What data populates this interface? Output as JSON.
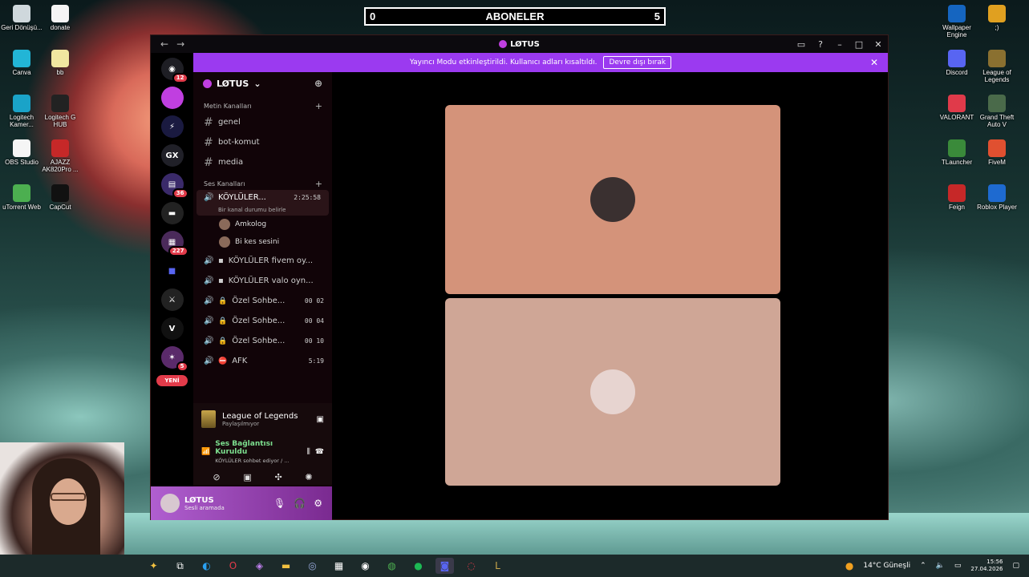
{
  "subscriber_bar": {
    "left_value": "0",
    "label": "ABONELER",
    "right_value": "5"
  },
  "desktop_left": [
    {
      "label": "Geri Dönüşü...",
      "icon": "recycle-bin-icon",
      "color": "#cfd8dc"
    },
    {
      "label": "donate",
      "icon": "file-icon",
      "color": "#f5f5f5"
    },
    {
      "label": "Canva",
      "icon": "canva-icon",
      "color": "#22b5d6"
    },
    {
      "label": "bb",
      "icon": "file-icon",
      "color": "#f1e6a0"
    },
    {
      "label": "Logitech Kamer...",
      "icon": "logitech-icon",
      "color": "#1aa3c8"
    },
    {
      "label": "Logitech G HUB",
      "icon": "logitech-g-icon",
      "color": "#222"
    },
    {
      "label": "OBS Studio",
      "icon": "file-icon",
      "color": "#f5f5f5"
    },
    {
      "label": "AJAZZ AK820Pro ...",
      "icon": "ajazz-icon",
      "color": "#c62828"
    },
    {
      "label": "uTorrent Web",
      "icon": "utorrent-icon",
      "color": "#4caf50"
    },
    {
      "label": "CapCut",
      "icon": "capcut-icon",
      "color": "#111"
    }
  ],
  "desktop_right": [
    {
      "label": "Wallpaper Engine",
      "icon": "wallpaper-engine-icon",
      "color": "#1565c0"
    },
    {
      "label": ";)",
      "icon": "folder-icon",
      "color": "#e0a020"
    },
    {
      "label": "Discord",
      "icon": "discord-icon",
      "color": "#5865f2"
    },
    {
      "label": "League of Legends",
      "icon": "lol-icon",
      "color": "#8a7030"
    },
    {
      "label": "VALORANT",
      "icon": "valorant-icon",
      "color": "#e03a4a"
    },
    {
      "label": "Grand Theft Auto V",
      "icon": "gta-icon",
      "color": "#4a6a4a"
    },
    {
      "label": "TLauncher",
      "icon": "tlauncher-icon",
      "color": "#3a8a3a"
    },
    {
      "label": "FiveM",
      "icon": "fivem-icon",
      "color": "#e05030"
    },
    {
      "label": "Feign",
      "icon": "feign-icon",
      "color": "#c62828"
    },
    {
      "label": "Roblox Player",
      "icon": "roblox-icon",
      "color": "#1e6ad0"
    }
  ],
  "window": {
    "title": "LØTUS",
    "back": "←",
    "forward": "→",
    "banner_text": "Yayıncı Modu etkinleştirildi. Kullanıcı adları kısaltıldı.",
    "banner_button": "Devre dışı bırak",
    "banner_close": "✕"
  },
  "rail": {
    "home_badge": "12",
    "badge_36": "36",
    "badge_227": "227",
    "badge_5": "5",
    "new_label": "YENİ"
  },
  "sidebar": {
    "server_name": "LØTUS",
    "text_category": "Metin Kanalları",
    "text_channels": [
      {
        "name": "genel"
      },
      {
        "name": "bot-komut"
      },
      {
        "name": "media"
      }
    ],
    "voice_category": "Ses Kanalları",
    "active_voice": {
      "name": "KÖYLÜLER...",
      "time": "2:25:58",
      "status": "Bir kanal durumu belirle"
    },
    "members": [
      {
        "name": "Amkolog"
      },
      {
        "name": "Bi kes sesini"
      }
    ],
    "voice_channels": [
      {
        "name": "KÖYLÜLER fivem oy...",
        "meta": "",
        "icon": "dm"
      },
      {
        "name": "KÖYLÜLER valo oyn...",
        "meta": "",
        "icon": "dm"
      },
      {
        "name": "Özel Sohbe...",
        "meta": "00  02",
        "icon": "lock"
      },
      {
        "name": "Özel Sohbe...",
        "meta": "00  04",
        "icon": "lock"
      },
      {
        "name": "Özel Sohbe...",
        "meta": "00  10",
        "icon": "lock"
      },
      {
        "name": "AFK",
        "meta": "5:19",
        "icon": "stop"
      }
    ]
  },
  "activity": {
    "game": "League of Legends",
    "status": "Paylaşılmıyor"
  },
  "voice_panel": {
    "connected": "Ses Bağlantısı Kuruldu",
    "where": "KÖYLÜLER sohbet ediyor / ..."
  },
  "user_panel": {
    "name": "LØTUS",
    "status": "Sesli aramada"
  },
  "tiles": [
    {
      "color": "#d4937a",
      "avatar_color": "#3a3030"
    },
    {
      "color": "#cfa696",
      "avatar_color": "#e7d4d0"
    }
  ],
  "taskbar": {
    "weather": "14°C  Güneşli",
    "time": "15:56",
    "date": "27.04.2026"
  }
}
